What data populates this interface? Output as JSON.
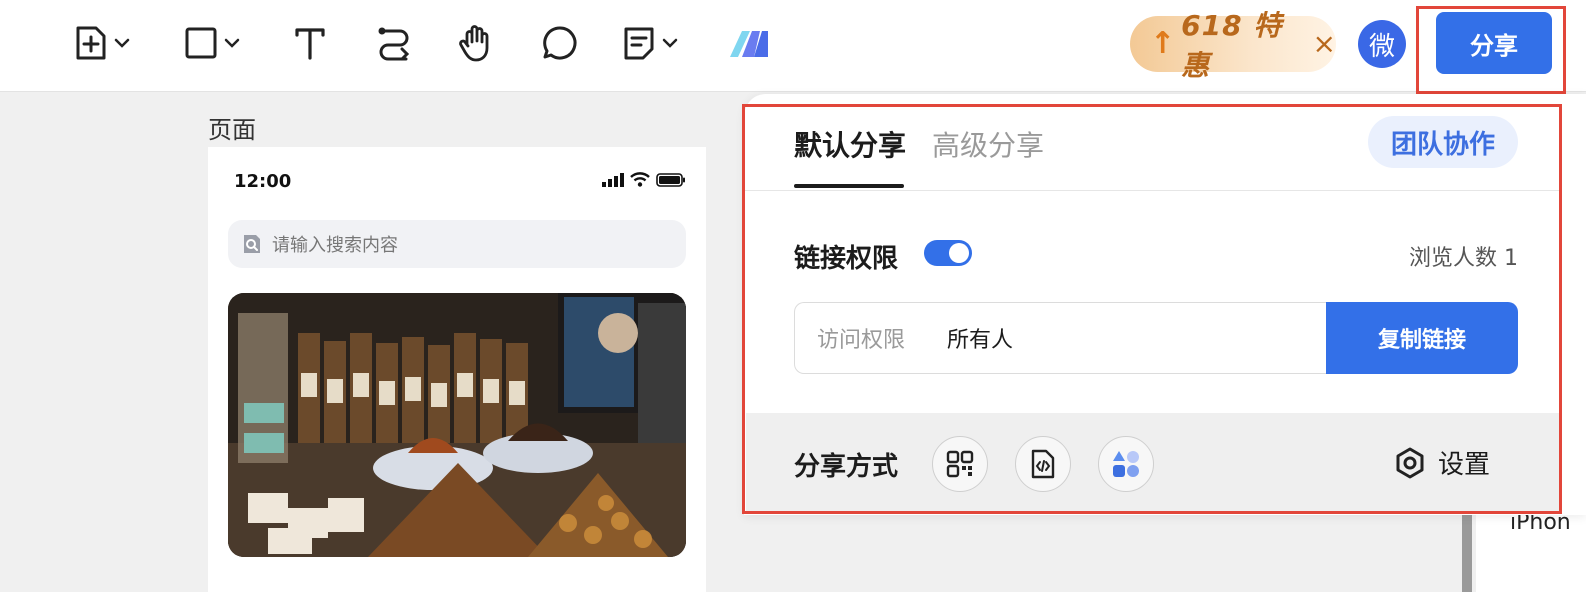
{
  "toolbar": {
    "tools": [
      "add-page-icon",
      "rectangle-icon",
      "text-icon",
      "connector-icon",
      "hand-icon",
      "comment-icon",
      "sticky-note-icon",
      "ai-logo-icon"
    ],
    "promo_text": "618 特惠",
    "promo_close": "×",
    "avatar_text": "微",
    "share_label": "分享"
  },
  "canvas": {
    "page_label": "页面",
    "status_time": "12:00",
    "search_placeholder": "请输入搜索内容"
  },
  "share_panel": {
    "tabs": [
      {
        "label": "默认分享",
        "active": true
      },
      {
        "label": "高级分享",
        "active": false
      }
    ],
    "team_label": "团队协作",
    "link_permission_label": "链接权限",
    "link_permission_enabled": true,
    "viewers_text": "浏览人数 1",
    "access_label": "访问权限",
    "access_value": "所有人",
    "copy_label": "复制链接",
    "share_methods_label": "分享方式",
    "share_methods": [
      "qrcode-icon",
      "embed-code-icon",
      "apps-icon"
    ],
    "settings_label": "设置"
  },
  "right_panel": {
    "partial_text": "iPhon"
  },
  "colors": {
    "primary": "#3370e8",
    "highlight_outline": "#e2463a",
    "promo_text": "#b8681c"
  }
}
